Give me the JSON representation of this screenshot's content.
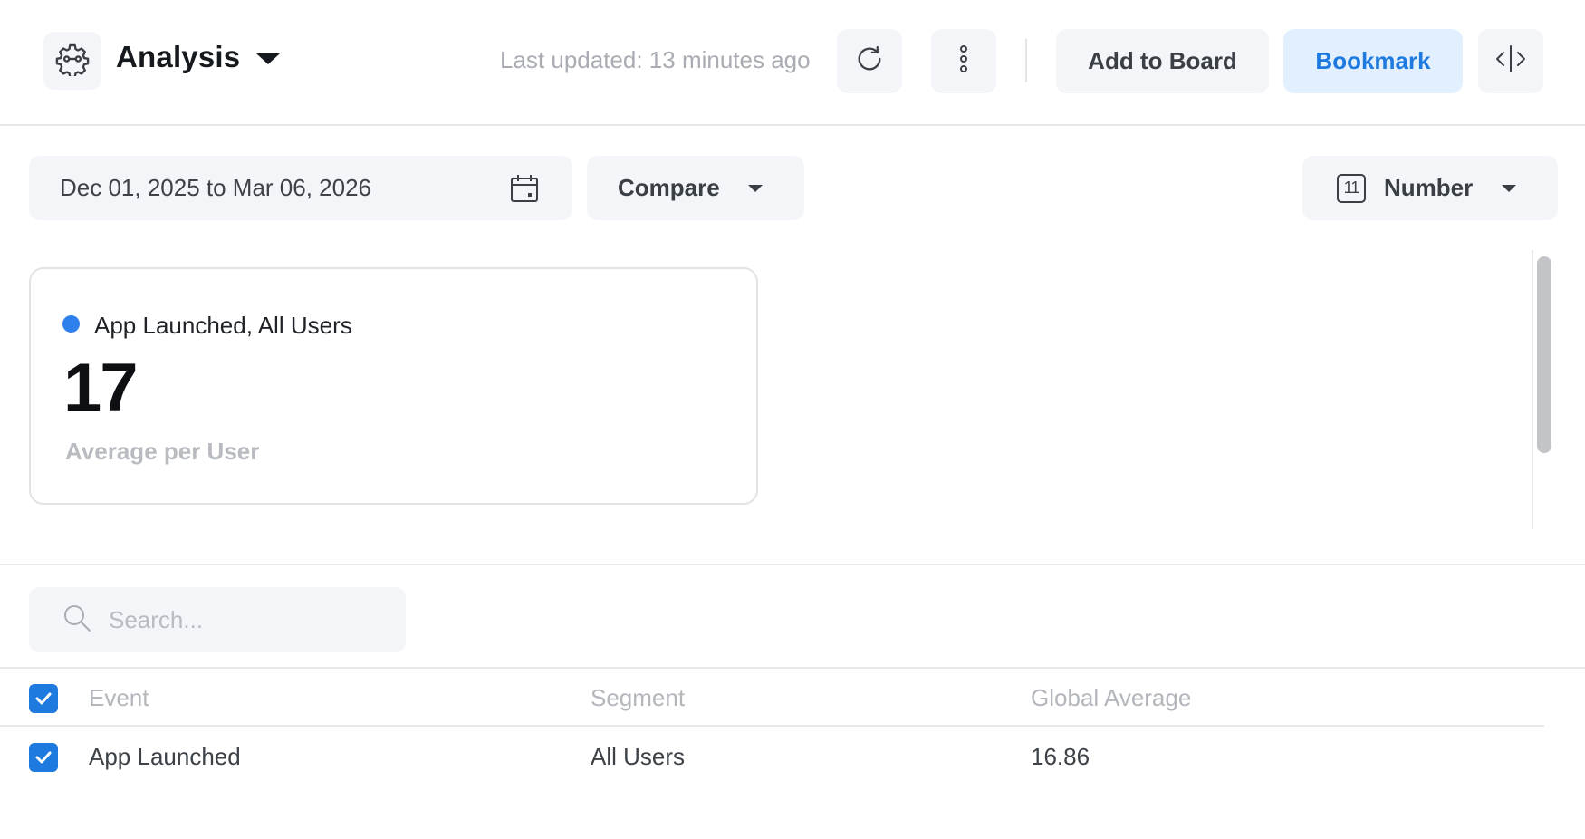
{
  "header": {
    "title": "Analysis",
    "last_updated": "Last updated: 13 minutes ago",
    "add_to_board_label": "Add to Board",
    "bookmark_label": "Bookmark",
    "icons": [
      "settings-gear-icon",
      "refresh-icon",
      "more-vertical-icon",
      "split-view-icon"
    ]
  },
  "controls": {
    "date_range": "Dec 01, 2025 to Mar 06, 2026",
    "compare_label": "Compare",
    "visualization": {
      "icon_text": "11",
      "label": "Number"
    }
  },
  "metric_card": {
    "series_label": "App Launched, All Users",
    "series_color": "#2f80ed",
    "value": "17",
    "subtitle": "Average per User"
  },
  "search": {
    "placeholder": "Search..."
  },
  "table": {
    "header_checked": true,
    "columns": [
      "Event",
      "Segment",
      "Global Average"
    ],
    "rows": [
      {
        "checked": true,
        "event": "App Launched",
        "segment": "All Users",
        "global_average": "16.86"
      }
    ]
  },
  "colors": {
    "accent": "#1f7ae0",
    "bookmark_bg": "#e1efff",
    "button_bg": "#f3f5f8",
    "muted_text": "#b8bcc1"
  }
}
